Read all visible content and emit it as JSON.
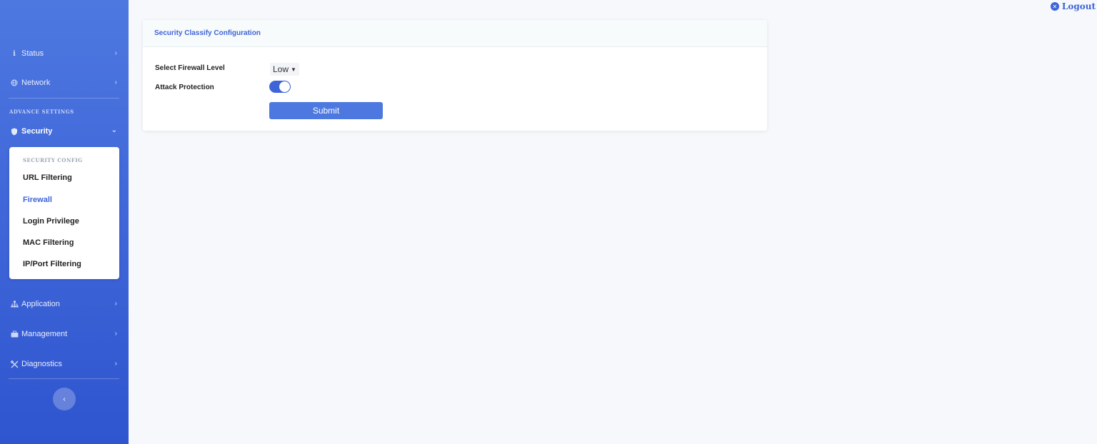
{
  "sidebar": {
    "items_top": [
      {
        "label": "Status",
        "icon": "info-icon"
      },
      {
        "label": "Network",
        "icon": "globe-icon"
      }
    ],
    "section_label": "ADVANCE SETTINGS",
    "security": {
      "label": "Security",
      "icon": "shield-icon"
    },
    "submenu": {
      "label": "SECURITY CONFIG",
      "items": [
        "URL Filtering",
        "Firewall",
        "Login Privilege",
        "MAC Filtering",
        "IP/Port Filtering"
      ],
      "active": "Firewall"
    },
    "items_bottom": [
      {
        "label": "Application",
        "icon": "sitemap-icon"
      },
      {
        "label": "Management",
        "icon": "briefcase-icon"
      },
      {
        "label": "Diagnostics",
        "icon": "tools-icon"
      }
    ],
    "collapse_glyph": "‹"
  },
  "header": {
    "logout_label": "Logout"
  },
  "card": {
    "title": "Security Classify Configuration",
    "firewall_level_label": "Select Firewall Level",
    "firewall_level_value": "Low",
    "attack_protection_label": "Attack Protection",
    "attack_protection_on": true,
    "submit_label": "Submit"
  },
  "colors": {
    "accent": "#3e64d8",
    "sidebar_top": "#4d78e0",
    "sidebar_bottom": "#2f55cf",
    "background": "#f6f8fb"
  }
}
